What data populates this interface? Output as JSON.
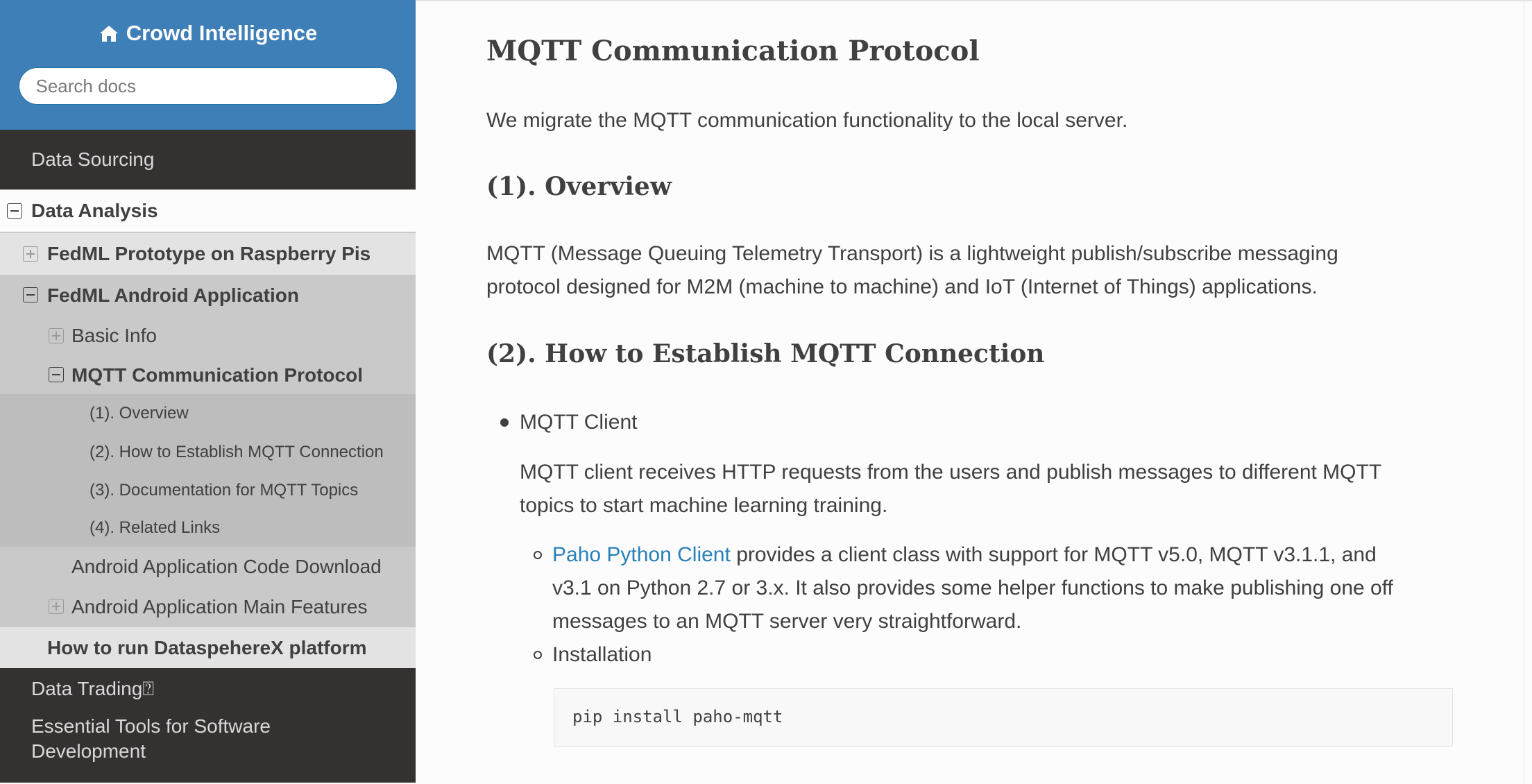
{
  "sidebar": {
    "brand": "Crowd Intelligence",
    "search_placeholder": "Search docs",
    "items": {
      "data_sourcing": "Data Sourcing",
      "data_analysis": "Data Analysis",
      "fedml_prototype": "FedML Prototype on Raspberry Pis",
      "fedml_android": "FedML Android Application",
      "basic_info": "Basic Info",
      "mqtt_protocol": "MQTT Communication Protocol",
      "overview": "(1). Overview",
      "establish": "(2). How to Establish MQTT Connection",
      "documentation": "(3). Documentation for MQTT Topics",
      "related_links": "(4). Related Links",
      "code_download": "Android Application Code Download",
      "main_features": "Android Application Main Features",
      "datasphere": "How to run DataspehereX platform",
      "data_trading": "Data Trading⍰",
      "essential_tools_1": "Essential Tools for Software",
      "essential_tools_2": "Development"
    }
  },
  "main": {
    "title": "MQTT Communication Protocol",
    "intro": "We migrate the MQTT communication functionality to the local server.",
    "overview_heading": "(1). Overview",
    "overview_p1": "MQTT (Message Queuing Telemetry Transport) is a lightweight publish/subscribe messaging",
    "overview_p2": "protocol designed for M2M (machine to machine) and IoT (Internet of Things) applications.",
    "establish_heading": "(2). How to Establish MQTT Connection",
    "mqtt_client_label": "MQTT Client",
    "mqtt_client_p1": "MQTT client receives HTTP requests from the users and publish messages to different MQTT",
    "mqtt_client_p2": "topics to start machine learning training.",
    "paho_link": "Paho Python Client",
    "paho_p1": "provides a client class with support for MQTT v5.0, MQTT v3.1.1, and",
    "paho_p2": "v3.1 on Python 2.7 or 3.x. It also provides some helper functions to make publishing one off",
    "paho_p3": "messages to an MQTT server very straightforward.",
    "installation_label": "Installation",
    "install_cmd": "pip install paho-mqtt"
  }
}
